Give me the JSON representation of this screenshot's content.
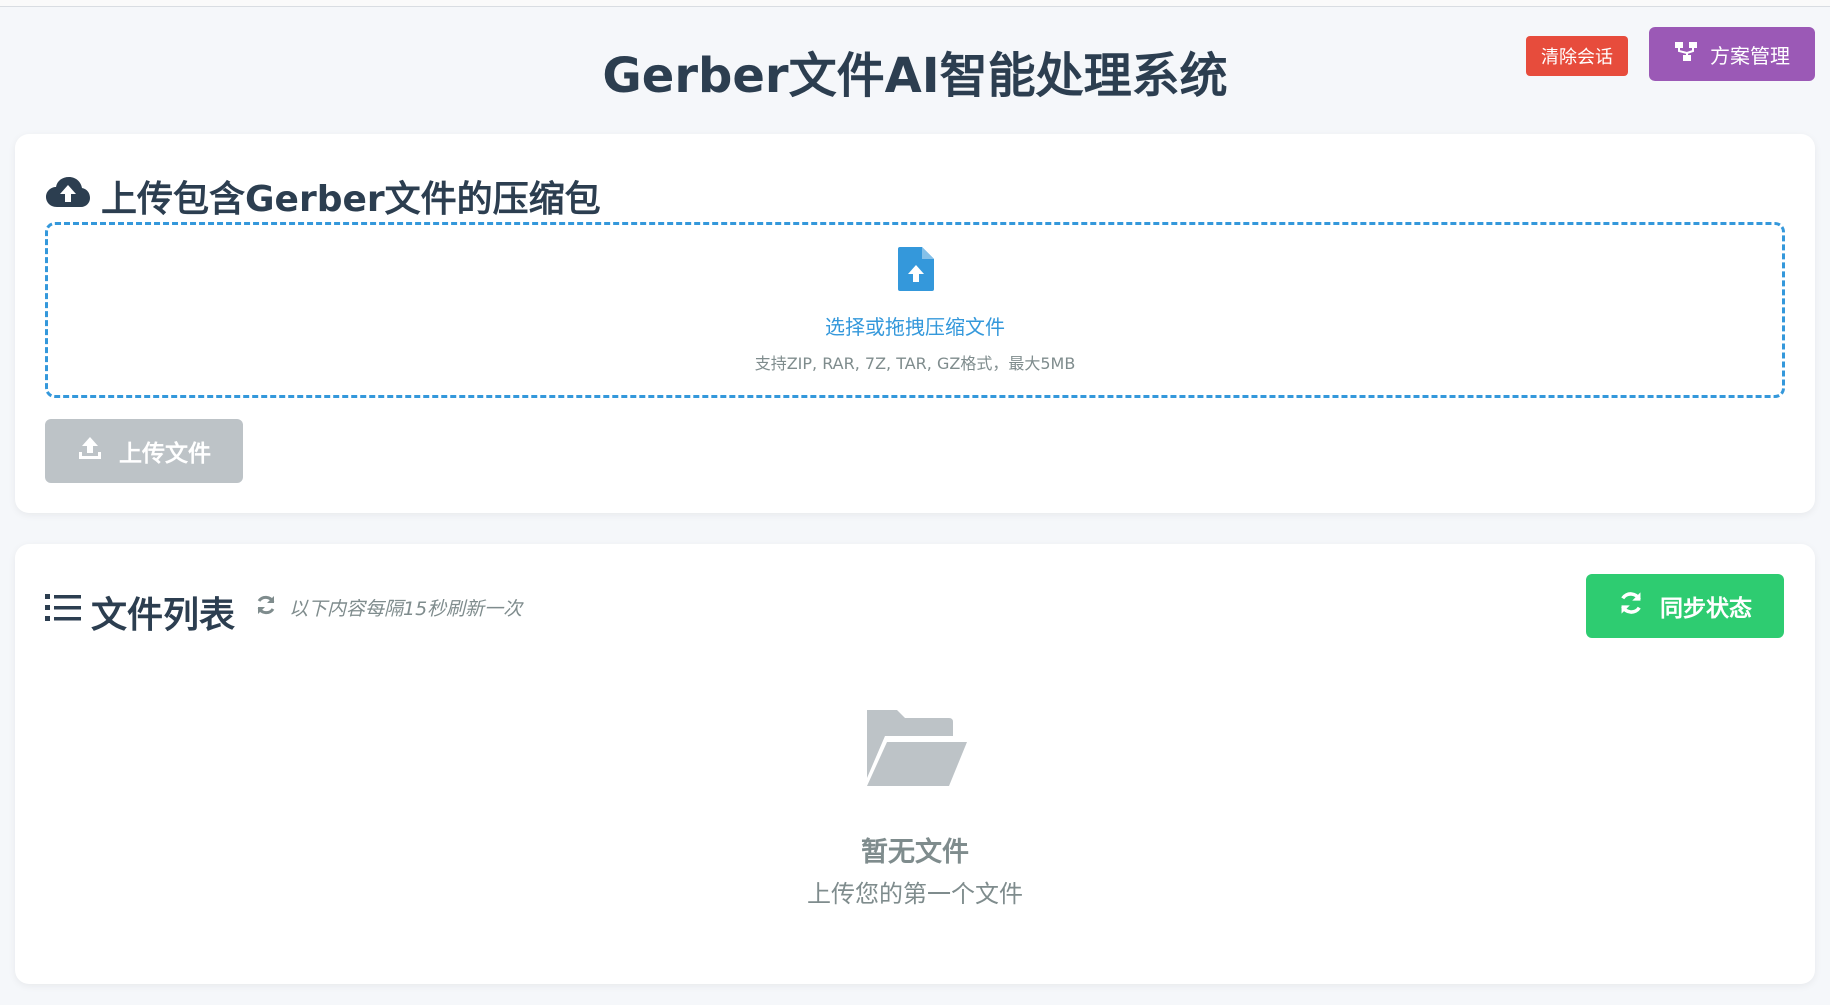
{
  "header": {
    "title": "Gerber文件AI智能处理系统",
    "clear_label": "清除会话",
    "plan_label": "方案管理"
  },
  "upload": {
    "title": "上传包含Gerber文件的压缩包",
    "drop_label": "选择或拖拽压缩文件",
    "drop_hint": "支持ZIP, RAR, 7Z, TAR, GZ格式，最大5MB",
    "upload_button": "上传文件"
  },
  "files": {
    "title": "文件列表",
    "refresh_note": "以下内容每隔15秒刷新一次",
    "sync_button": "同步状态",
    "empty_title": "暂无文件",
    "empty_subtitle": "上传您的第一个文件"
  },
  "colors": {
    "clear": "#e74c3c",
    "plan": "#9b59b6",
    "accent": "#3498db",
    "sync": "#2ecc71",
    "disabled": "#bdc3c7"
  },
  "icons": {
    "upload_section": "cloud-upload-icon",
    "drop": "file-upload-icon",
    "upload_button": "upload-icon",
    "files_section": "list-icon",
    "refresh": "refresh-icon",
    "sync": "sync-icon",
    "empty": "folder-open-icon",
    "plan": "sitemap-icon"
  }
}
